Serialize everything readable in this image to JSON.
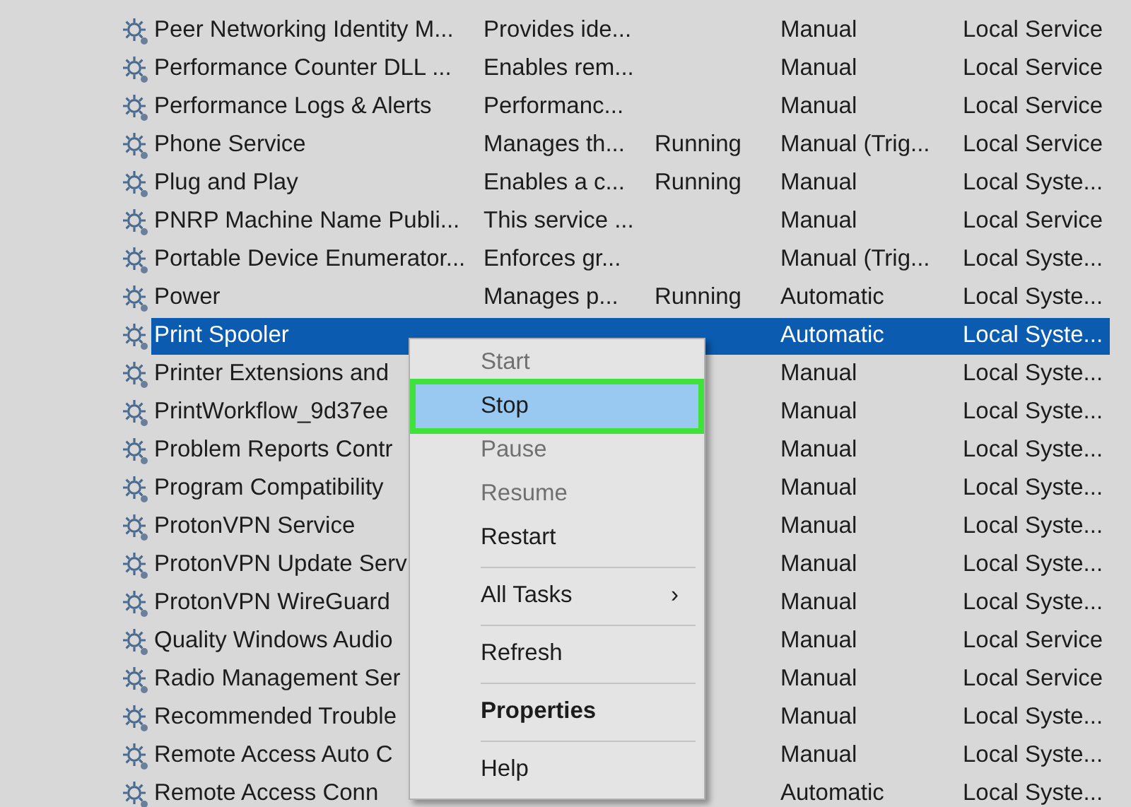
{
  "services": [
    {
      "name": "Peer Networking Identity M...",
      "description": "Provides ide...",
      "startup": "Manual",
      "logon": "Local Service",
      "selected": false
    },
    {
      "name": "Performance Counter DLL ...",
      "description": "Enables rem...",
      "startup": "Manual",
      "logon": "Local Service",
      "selected": false
    },
    {
      "name": "Performance Logs & Alerts",
      "description": "Performanc...",
      "startup": "Manual",
      "logon": "Local Service",
      "selected": false
    },
    {
      "name": "Phone Service",
      "description": "Manages th...",
      "status": "Running",
      "startup": "Manual (Trig...",
      "logon": "Local Service",
      "selected": false
    },
    {
      "name": "Plug and Play",
      "description": "Enables a c...",
      "status": "Running",
      "startup": "Manual",
      "logon": "Local Syste...",
      "selected": false
    },
    {
      "name": "PNRP Machine Name Publi...",
      "description": "This service ...",
      "startup": "Manual",
      "logon": "Local Service",
      "selected": false
    },
    {
      "name": "Portable Device Enumerator...",
      "description": "Enforces gr...",
      "startup": "Manual (Trig...",
      "logon": "Local Syste...",
      "selected": false
    },
    {
      "name": "Power",
      "description": "Manages p...",
      "status": "Running",
      "startup": "Automatic",
      "logon": "Local Syste...",
      "selected": false
    },
    {
      "name": "Print Spooler",
      "startup": "Automatic",
      "logon": "Local Syste...",
      "selected": true
    },
    {
      "name": "Printer Extensions and",
      "startup": "Manual",
      "logon": "Local Syste...",
      "selected": false
    },
    {
      "name": "PrintWorkflow_9d37ee",
      "startup": "Manual",
      "logon": "Local Syste...",
      "selected": false
    },
    {
      "name": "Problem Reports Contr",
      "startup": "Manual",
      "logon": "Local Syste...",
      "selected": false
    },
    {
      "name": "Program Compatibility",
      "startup": "Manual",
      "logon": "Local Syste...",
      "selected": false
    },
    {
      "name": "ProtonVPN Service",
      "startup": "Manual",
      "logon": "Local Syste...",
      "selected": false
    },
    {
      "name": "ProtonVPN Update Serv",
      "startup": "Manual",
      "logon": "Local Syste...",
      "selected": false
    },
    {
      "name": "ProtonVPN WireGuard",
      "startup": "Manual",
      "logon": "Local Syste...",
      "selected": false
    },
    {
      "name": "Quality Windows Audio",
      "startup": "Manual",
      "logon": "Local Service",
      "selected": false
    },
    {
      "name": "Radio Management Ser",
      "startup": "Manual",
      "logon": "Local Service",
      "selected": false
    },
    {
      "name": "Recommended Trouble",
      "startup": "Manual",
      "logon": "Local Syste...",
      "selected": false
    },
    {
      "name": "Remote Access Auto C",
      "startup": "Manual",
      "logon": "Local Syste...",
      "selected": false
    },
    {
      "name": "Remote Access Conn",
      "startup": "Automatic",
      "logon": "Local Syste...",
      "selected": false
    }
  ],
  "context_menu": [
    {
      "kind": "item",
      "label": "Start",
      "disabled": true,
      "selected": false
    },
    {
      "kind": "item",
      "label": "Stop",
      "disabled": false,
      "selected": true
    },
    {
      "kind": "item",
      "label": "Pause",
      "disabled": true,
      "selected": false
    },
    {
      "kind": "item",
      "label": "Resume",
      "disabled": true,
      "selected": false
    },
    {
      "kind": "item",
      "label": "Restart",
      "disabled": false,
      "selected": false
    },
    {
      "kind": "separator"
    },
    {
      "kind": "item",
      "label": "All Tasks",
      "disabled": false,
      "selected": false,
      "submenu": "›"
    },
    {
      "kind": "separator"
    },
    {
      "kind": "item",
      "label": "Refresh",
      "disabled": false,
      "selected": false
    },
    {
      "kind": "separator"
    },
    {
      "kind": "item",
      "label": "Properties",
      "disabled": false,
      "selected": false,
      "default": true
    },
    {
      "kind": "separator"
    },
    {
      "kind": "item",
      "label": "Help",
      "disabled": false,
      "selected": false
    }
  ]
}
